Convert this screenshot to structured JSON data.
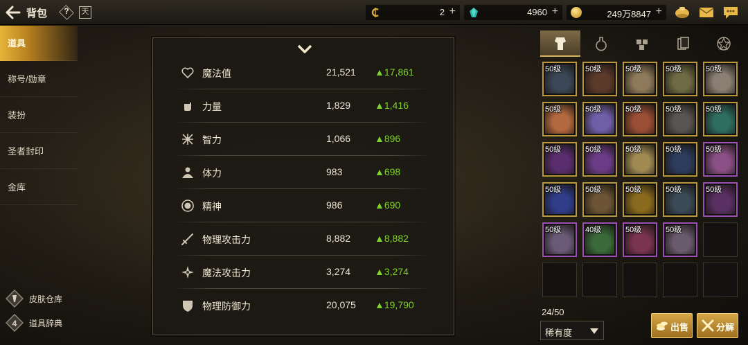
{
  "header": {
    "title": "背包",
    "calendar_glyph": "天",
    "currencies": [
      {
        "name": "coin-c",
        "value": "2",
        "color": "#d4a63c"
      },
      {
        "name": "crystal",
        "value": "4960",
        "color": "#27b7a6"
      },
      {
        "name": "gold",
        "value": "249万8847",
        "color": "#e3b233"
      }
    ]
  },
  "sidebar": {
    "items": [
      {
        "label": "道具",
        "active": true
      },
      {
        "label": "称号/勋章",
        "active": false
      },
      {
        "label": "装扮",
        "active": false
      },
      {
        "label": "圣者封印",
        "active": false
      },
      {
        "label": "金库",
        "active": false
      }
    ],
    "bottom": [
      {
        "label": "皮肤仓库",
        "icon": "skin-storage-icon"
      },
      {
        "label": "道具辞典",
        "icon": "item-dictionary-icon"
      }
    ]
  },
  "stats": [
    {
      "name": "魔法值",
      "value": "21,521",
      "bonus": "▲17,861",
      "icon": "heart-icon"
    },
    {
      "name": "力量",
      "value": "1,829",
      "bonus": "▲1,416",
      "icon": "fist-icon"
    },
    {
      "name": "智力",
      "value": "1,066",
      "bonus": "▲896",
      "icon": "intellect-icon"
    },
    {
      "name": "体力",
      "value": "983",
      "bonus": "▲698",
      "icon": "stamina-icon"
    },
    {
      "name": "精神",
      "value": "986",
      "bonus": "▲690",
      "icon": "spirit-icon"
    },
    {
      "name": "物理攻击力",
      "value": "8,882",
      "bonus": "▲8,882",
      "icon": "sword-icon"
    },
    {
      "name": "魔法攻击力",
      "value": "3,274",
      "bonus": "▲3,274",
      "icon": "magic-icon"
    },
    {
      "name": "物理防御力",
      "value": "20,075",
      "bonus": "▲19,790",
      "icon": "shield-icon"
    }
  ],
  "inventory": {
    "tabs": [
      "equipment-tab",
      "potion-tab",
      "material-tab",
      "card-tab",
      "pentagram-tab"
    ],
    "slots": [
      {
        "level": "50级",
        "tone": "#3b4756",
        "rarity": "gold"
      },
      {
        "level": "50级",
        "tone": "#5c3a2a",
        "rarity": "gold"
      },
      {
        "level": "50级",
        "tone": "#8e7a5a",
        "rarity": "gold"
      },
      {
        "level": "50级",
        "tone": "#6e6a44",
        "rarity": "gold"
      },
      {
        "level": "50级",
        "tone": "#8a7f72",
        "rarity": "gold"
      },
      {
        "level": "50级",
        "tone": "#b3683f",
        "rarity": "gold"
      },
      {
        "level": "50级",
        "tone": "#6f5fa8",
        "rarity": "gold"
      },
      {
        "level": "50级",
        "tone": "#9a4e35",
        "rarity": "gold"
      },
      {
        "level": "50级",
        "tone": "#575452",
        "rarity": "gold"
      },
      {
        "level": "50级",
        "tone": "#2e6e60",
        "rarity": "gold"
      },
      {
        "level": "50级",
        "tone": "#5a2e6e",
        "rarity": "gold"
      },
      {
        "level": "50级",
        "tone": "#6b3c86",
        "rarity": "gold"
      },
      {
        "level": "50级",
        "tone": "#a08a52",
        "rarity": "gold"
      },
      {
        "level": "50级",
        "tone": "#2d3c5c",
        "rarity": "gold"
      },
      {
        "level": "50级",
        "tone": "#8a4f84",
        "rarity": "purple"
      },
      {
        "level": "50级",
        "tone": "#2f3d8a",
        "rarity": "gold"
      },
      {
        "level": "50级",
        "tone": "#6c5435",
        "rarity": "gold"
      },
      {
        "level": "50级",
        "tone": "#8a6a1e",
        "rarity": "gold"
      },
      {
        "level": "50级",
        "tone": "#3a4a56",
        "rarity": "gold"
      },
      {
        "level": "50级",
        "tone": "#5a3064",
        "rarity": "purple"
      },
      {
        "level": "50级",
        "tone": "#6a5a78",
        "rarity": "purple"
      },
      {
        "level": "40级",
        "tone": "#3b6a3a",
        "rarity": "purple"
      },
      {
        "level": "50级",
        "tone": "#7a3450",
        "rarity": "purple"
      },
      {
        "level": "50级",
        "tone": "#6a5a6e",
        "rarity": "purple"
      },
      {
        "level": "",
        "tone": "",
        "rarity": "empty"
      },
      {
        "level": "",
        "tone": "",
        "rarity": "empty"
      },
      {
        "level": "",
        "tone": "",
        "rarity": "empty"
      },
      {
        "level": "",
        "tone": "",
        "rarity": "empty"
      },
      {
        "level": "",
        "tone": "",
        "rarity": "empty"
      },
      {
        "level": "",
        "tone": "",
        "rarity": "empty"
      }
    ],
    "count": "24/50",
    "sort_label": "稀有度",
    "sell_label": "出售",
    "disassemble_label": "分解"
  }
}
